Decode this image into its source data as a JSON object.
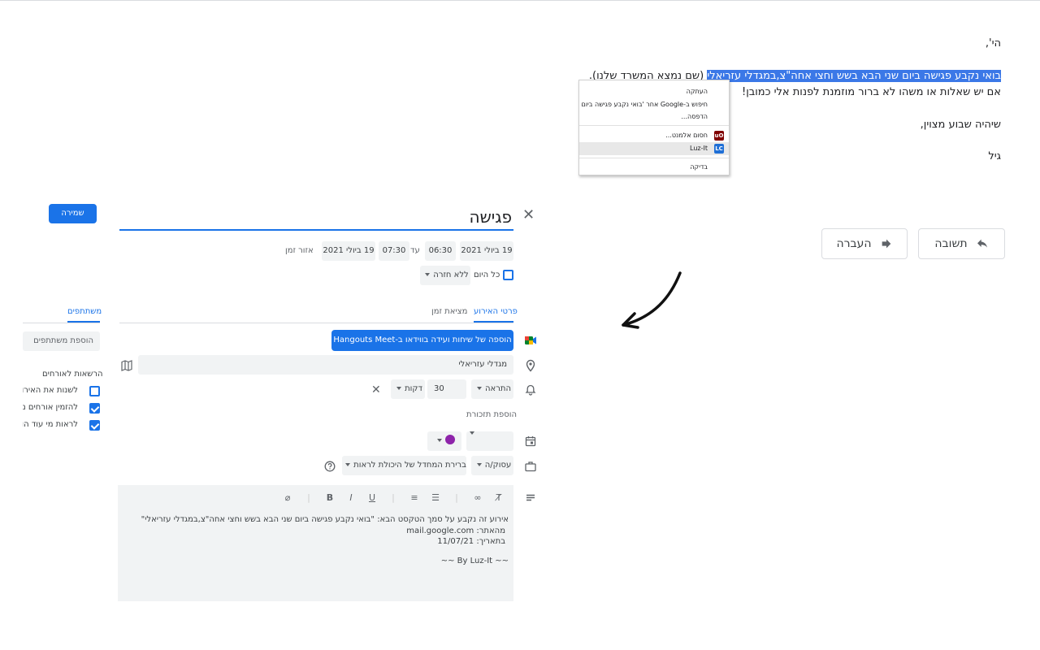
{
  "email": {
    "greeting": "הי',",
    "highlighted_text": "בואי נקבע פגישה ביום שני הבא בשש וחצי אחה\"צ,במגדלי עזריאלי",
    "line1_rest": " (שם נמצא המשרד שלנו).",
    "line2": "אם יש שאלות או משהו לא ברור מוזמנת לפנות אלי כמובן!",
    "line3": "שיהיה שבוע מצוין,",
    "signature": "גיל",
    "reply_label": "תשובה",
    "forward_label": "העברה"
  },
  "context_menu": {
    "items": [
      {
        "label": "העתקה"
      },
      {
        "label": "חיפוש ב-Google אחר 'בואי נקבע פגישה ביום"
      },
      {
        "label": "הדפסה..."
      },
      {
        "label": "חסום אלמנט...",
        "icon": "ublock-icon",
        "icon_text": "uO",
        "icon_color": "#800000"
      },
      {
        "label": "Luz-It",
        "icon": "luzit-icon",
        "icon_text": "LC",
        "icon_color": "#1f6fd6"
      },
      {
        "label": "בדיקה"
      }
    ]
  },
  "event": {
    "title": "פגישה",
    "save_label": "שמירה",
    "start_date": "19 ביולי 2021",
    "start_time": "06:30",
    "to_label": "עד",
    "end_time": "07:30",
    "end_date": "19 ביולי 2021",
    "timezone_label": "אזור זמן",
    "all_day_label": "כל היום",
    "repeat_value": "ללא חזרה",
    "tabs": [
      {
        "label": "פרטי האירוע"
      },
      {
        "label": "מציאת זמן"
      }
    ],
    "meet_button_label": "הוספה של שיחות ועידה בווידאו ב-Hangouts Meet",
    "location": "מגדלי עזריאלי",
    "notification_type": "התראה",
    "notification_value": "30",
    "notification_unit": "דקות",
    "add_notification_label": "הוספת תזכורת",
    "event_color": "#8e24aa",
    "busy_value": "עסוק/ה",
    "visibility_value": "ברירת המחדל של היכולת לראות",
    "description_lines": [
      "אירוע זה נקבע על סמך הטקסט הבא: \"בואי נקבע פגישה ביום שני הבא בשש וחצי אחה\"צ,במגדלי עזריאלי\"",
      "מהאתר: mail.google.com",
      "בתאריך: 11/07/21",
      "~~ By Luz-It ~~"
    ]
  },
  "guests": {
    "tab_label": "משתתפים",
    "add_placeholder": "הוספת משתתפים",
    "permissions_title": "הרשאות לאורחים",
    "permissions": [
      {
        "label": "לשנות את האירוע",
        "checked": false
      },
      {
        "label": "להזמין אורחים נוספים",
        "checked": true
      },
      {
        "label": "לראות מי עוד הוזמן",
        "checked": true
      }
    ]
  }
}
